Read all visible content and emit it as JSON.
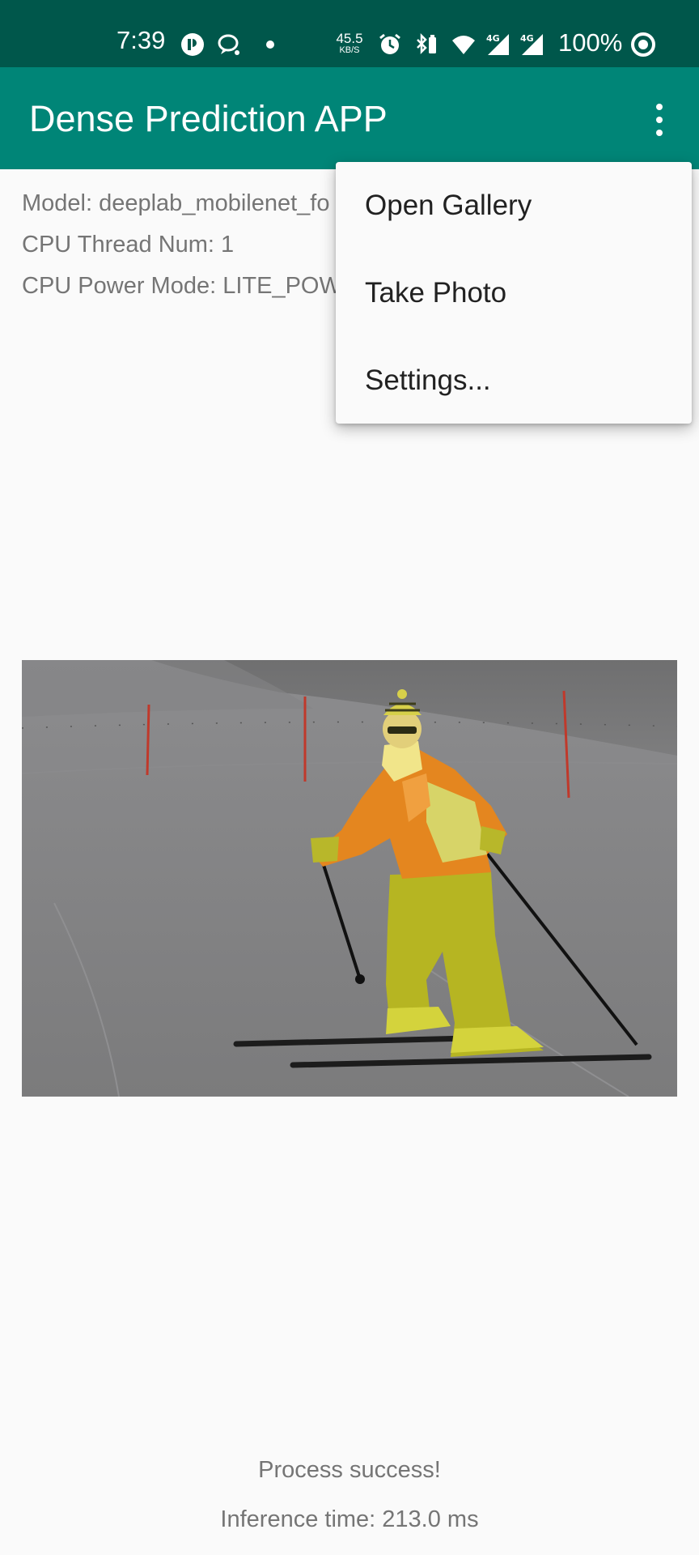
{
  "status_bar": {
    "time": "7:39",
    "net_speed_value": "45.5",
    "net_speed_unit": "KB/S",
    "battery": "100%",
    "icons": [
      "app-notification-icon",
      "chat-icon",
      "dot-icon",
      "alarm-icon",
      "bluetooth-battery-icon",
      "wifi-icon",
      "signal-4g-icon",
      "signal-4g-icon",
      "ring-icon"
    ]
  },
  "toolbar": {
    "title": "Dense Prediction APP",
    "overflow_icon": "more-vert-icon"
  },
  "info": {
    "model": "Model: deeplab_mobilenet_fo",
    "cpu_thread": "CPU Thread Num: 1",
    "cpu_power": "CPU Power Mode: LITE_POW"
  },
  "menu": {
    "items": [
      "Open Gallery",
      "Take Photo",
      "Settings..."
    ]
  },
  "result": {
    "status": "Process success!",
    "inference_time": "Inference time: 213.0 ms"
  },
  "colors": {
    "status_bar": "#00574b",
    "toolbar": "#008577",
    "segmentation_overlay": "#e6e600",
    "background": "#fafafa"
  }
}
